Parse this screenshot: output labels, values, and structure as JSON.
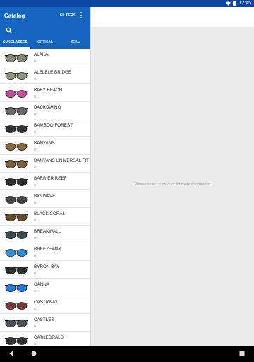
{
  "status": {
    "time": "12:45"
  },
  "appbar": {
    "title": "Catalog",
    "filters_label": "FILTERS"
  },
  "tabs": [
    "SUNGLASSES",
    "OPTICAL",
    "ZEAL"
  ],
  "products": [
    {
      "name": "ALAKAI",
      "sub": "Rx",
      "color": "#7e8c74"
    },
    {
      "name": "ALELELE BRIDGE",
      "sub": "Rx",
      "color": "#8d9a7a"
    },
    {
      "name": "BABY BEACH",
      "sub": "Rx",
      "color": "#c84aa0"
    },
    {
      "name": "BACKSWING",
      "sub": "Rx",
      "color": "#666666"
    },
    {
      "name": "BAMBOO FOREST",
      "sub": "Rx",
      "color": "#2e3135"
    },
    {
      "name": "BANYANS",
      "sub": "Rx",
      "color": "#8a6b3e"
    },
    {
      "name": "BANYANS UNIVERSAL FIT",
      "sub": "Rx",
      "color": "#7d5f38"
    },
    {
      "name": "BARRIER REEF",
      "sub": "Rx",
      "color": "#2b2b2b"
    },
    {
      "name": "BIG WAVE",
      "sub": "Rx",
      "color": "#444444"
    },
    {
      "name": "BLACK CORAL",
      "sub": "Rx",
      "color": "#6b4a2a"
    },
    {
      "name": "BREAKWALL",
      "sub": "Rx",
      "color": "#3a4a55"
    },
    {
      "name": "BREEZEWAY",
      "sub": "Rx",
      "color": "#2f8fd8"
    },
    {
      "name": "BYRON BAY",
      "sub": "Rx",
      "color": "#2c2c2c"
    },
    {
      "name": "CANNA",
      "sub": "Rx",
      "color": "#1e7be0"
    },
    {
      "name": "CASTAWAY",
      "sub": "Rx",
      "color": "#7a3b3b"
    },
    {
      "name": "CASTLES",
      "sub": "Rx",
      "color": "#4e5459"
    },
    {
      "name": "CATHEDRALS",
      "sub": "Rx",
      "color": "#333333"
    }
  ],
  "detail": {
    "placeholder": "Please select a product for more information"
  }
}
